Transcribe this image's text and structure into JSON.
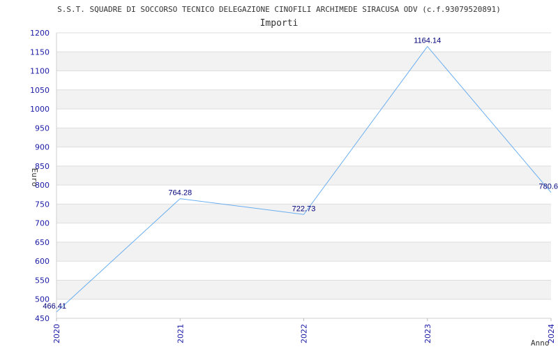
{
  "chart_data": {
    "type": "line",
    "title": "S.S.T. SQUADRE DI SOCCORSO TECNICO DELEGAZIONE CINOFILI ARCHIMEDE SIRACUSA ODV (c.f.93079520891)",
    "subtitle": "Importi",
    "xlabel": "Anno",
    "ylabel": "Euro",
    "categories": [
      "2020",
      "2021",
      "2022",
      "2023",
      "2024"
    ],
    "values": [
      466.41,
      764.28,
      722.73,
      1164.14,
      780.6
    ],
    "data_labels": [
      "466.41",
      "764.28",
      "722.73",
      "1164.14",
      "780.6"
    ],
    "ylim": [
      450,
      1200
    ],
    "yticks": [
      "450",
      "500",
      "550",
      "600",
      "650",
      "700",
      "750",
      "800",
      "850",
      "900",
      "950",
      "1000",
      "1050",
      "1100",
      "1150",
      "1200"
    ],
    "grid": true,
    "line_color": "#6aaef0",
    "band_color": "#f2f2f2"
  }
}
